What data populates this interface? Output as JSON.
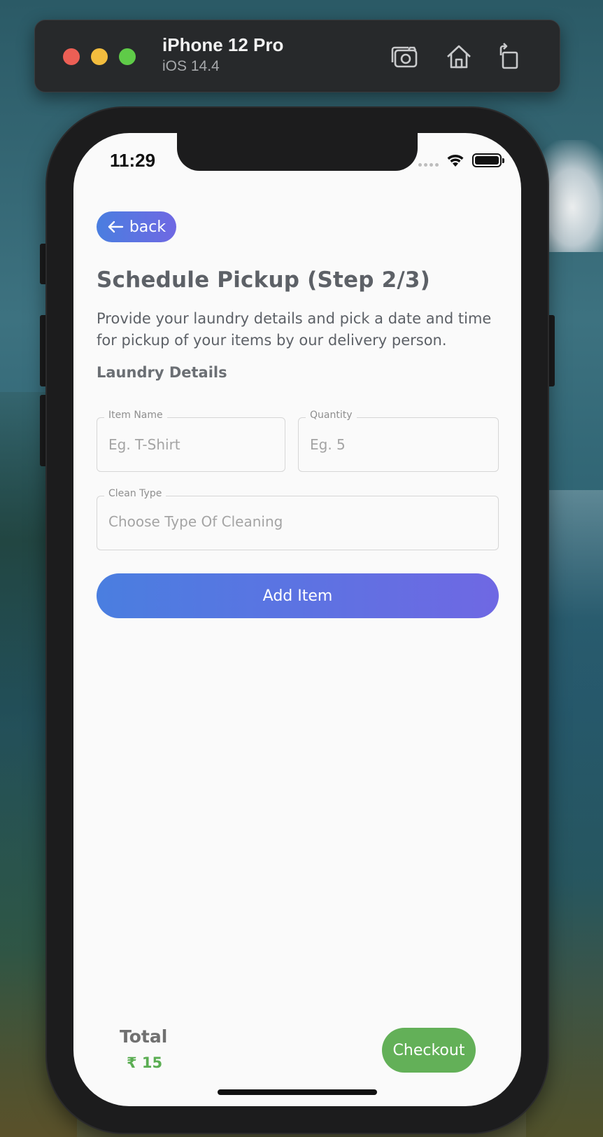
{
  "simulator": {
    "device_name": "iPhone 12 Pro",
    "os_version": "iOS 14.4",
    "icons": [
      "screenshot-icon",
      "home-icon",
      "rotate-icon"
    ]
  },
  "status_bar": {
    "time": "11:29",
    "icons": [
      "signal-dots-icon",
      "wifi-icon",
      "battery-icon"
    ]
  },
  "header": {
    "back_label": "back",
    "back_icon": "arrow-left-icon"
  },
  "page": {
    "title": "Schedule Pickup (Step 2/3)",
    "description": "Provide your laundry details and pick a date and time for pickup of your items by our delivery person.",
    "section_heading": "Laundry Details"
  },
  "form": {
    "item_name": {
      "label": "Item Name",
      "placeholder": "Eg. T-Shirt",
      "value": ""
    },
    "quantity": {
      "label": "Quantity",
      "placeholder": "Eg. 5",
      "value": ""
    },
    "clean_type": {
      "label": "Clean Type",
      "placeholder": "Choose Type Of Cleaning"
    },
    "add_button_label": "Add Item"
  },
  "footer": {
    "total_label": "Total",
    "total_value": "₹ 15",
    "checkout_label": "Checkout"
  },
  "colors": {
    "accent_gradient_start": "#4a7ee0",
    "accent_gradient_end": "#6f68e3",
    "checkout_green": "#63b058",
    "total_green": "#5aad52",
    "text_gray": "#5d6167"
  }
}
